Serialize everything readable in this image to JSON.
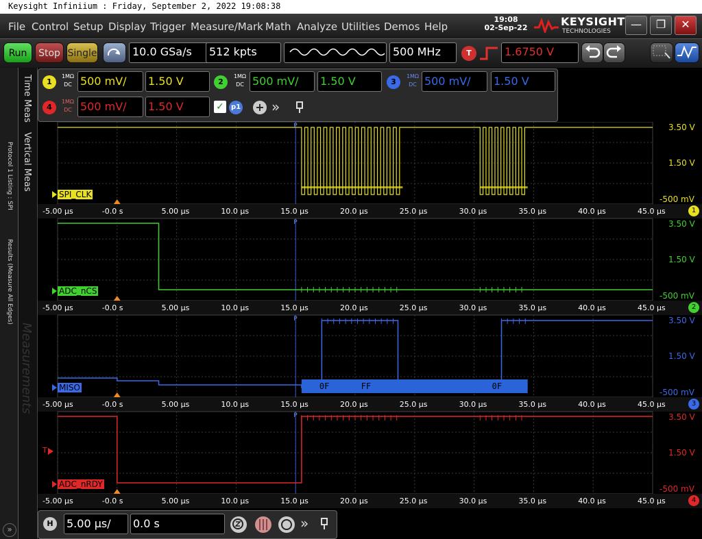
{
  "window": {
    "title": "Keysight Infiniium : Friday, September 2, 2022 19:08:38"
  },
  "menu": {
    "items": [
      "File",
      "Control",
      "Setup",
      "Display",
      "Trigger",
      "Measure/Mark",
      "Math",
      "Analyze",
      "Utilities",
      "Demos",
      "Help"
    ],
    "time": "19:08",
    "date": "02-Sep-22",
    "brand": "KEYSIGHT",
    "brand_sub": "TECHNOLOGIES",
    "minimize": "—",
    "restore": "❐",
    "close": "✕"
  },
  "toolbar": {
    "run": "Run",
    "stop": "Stop",
    "single": "Single",
    "sample_rate": "10.0 GSa/s",
    "memory": "512 kpts",
    "bandwidth": "500 MHz",
    "trigger_label": "T",
    "trigger_level": "1.6750 V",
    "trigger_color": "#e03030"
  },
  "sidebar": {
    "left_tab1": "Protocol 1 Listing : SPI",
    "left_tab2": "Results (Measure All Edges)",
    "tab_time": "Time Meas",
    "tab_vertical": "Vertical Meas",
    "tab_measurements": "Measurements",
    "expand": "»"
  },
  "channels": [
    {
      "num": "1",
      "coupling": "1MΩ",
      "dc": "DC",
      "scale": "500 mV/",
      "offset": "1.50 V",
      "color": "#e8e020"
    },
    {
      "num": "2",
      "coupling": "1MΩ",
      "dc": "DC",
      "scale": "500 mV/",
      "offset": "1.50 V",
      "color": "#40d030"
    },
    {
      "num": "3",
      "coupling": "1MΩ",
      "dc": "DC",
      "scale": "500 mV/",
      "offset": "1.50 V",
      "color": "#3a6ae8"
    },
    {
      "num": "4",
      "coupling": "1MΩ",
      "dc": "DC",
      "scale": "500 mV/",
      "offset": "1.50 V",
      "color": "#e02828"
    }
  ],
  "chanpanel": {
    "protocol": "p1",
    "add": "+",
    "more": "»"
  },
  "xaxis": {
    "ticks": [
      "-5.00 µs",
      "-0.0 s",
      "5.00 µs",
      "10.0 µs",
      "15.0 µs",
      "20.0 µs",
      "25.0 µs",
      "30.0 µs",
      "35.0 µs",
      "40.0 µs",
      "45.0 µs"
    ]
  },
  "panels": [
    {
      "name": "SPI_CLK",
      "color": "#e8e020",
      "v_top": "3.50 V",
      "v_mid": "1.50 V",
      "v_bot": "-500 mV",
      "badge": "1"
    },
    {
      "name": "ADC_nCS",
      "color": "#40d030",
      "v_top": "3.50 V",
      "v_mid": "1.50 V",
      "v_bot": "-500 mV",
      "badge": "2"
    },
    {
      "name": "MISO",
      "color": "#3a6ae8",
      "v_top": "3.50 V",
      "v_mid": "1.50 V",
      "v_bot": "-500 mV",
      "badge": "3"
    },
    {
      "name": "ADC_nRDY",
      "color": "#e02828",
      "v_top": "3.50 V",
      "v_mid": "1.50 V",
      "v_bot": "-500 mV",
      "badge": "4"
    }
  ],
  "decode": {
    "bytes": [
      "0F",
      "FF",
      "0F"
    ]
  },
  "markers": {
    "trigger_marker": "T",
    "trigger_pos": "P"
  },
  "bottom": {
    "h_label": "H",
    "timebase": "5.00 µs/",
    "position": "0.0 s",
    "more": "»"
  }
}
